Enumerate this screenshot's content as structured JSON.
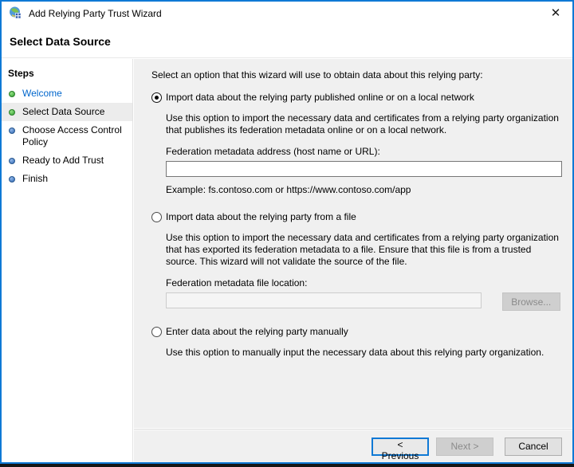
{
  "window": {
    "title": "Add Relying Party Trust Wizard",
    "close_glyph": "✕"
  },
  "header": {
    "title": "Select Data Source"
  },
  "sidebar": {
    "title": "Steps",
    "items": [
      {
        "label": "Welcome",
        "state": "done",
        "current": false
      },
      {
        "label": "Select Data Source",
        "state": "done",
        "current": true
      },
      {
        "label": "Choose Access Control Policy",
        "state": "todo",
        "current": false
      },
      {
        "label": "Ready to Add Trust",
        "state": "todo",
        "current": false
      },
      {
        "label": "Finish",
        "state": "todo",
        "current": false
      }
    ]
  },
  "main": {
    "instruction": "Select an option that this wizard will use to obtain data about this relying party:",
    "options": [
      {
        "label": "Import data about the relying party published online or on a local network",
        "selected": true,
        "description": "Use this option to import the necessary data and certificates from a relying party organization that publishes its federation metadata online or on a local network.",
        "field_label": "Federation metadata address (host name or URL):",
        "field_value": "",
        "example": "Example: fs.contoso.com or https://www.contoso.com/app"
      },
      {
        "label": "Import data about the relying party from a file",
        "selected": false,
        "description": "Use this option to import the necessary data and certificates from a relying party organization that has exported its federation metadata to a file. Ensure that this file is from a trusted source.  This wizard will not validate the source of the file.",
        "field_label": "Federation metadata file location:",
        "field_value": "",
        "browse_label": "Browse..."
      },
      {
        "label": "Enter data about the relying party manually",
        "selected": false,
        "description": "Use this option to manually input the necessary data about this relying party organization."
      }
    ]
  },
  "footer": {
    "previous_label": "< Previous",
    "next_label": "Next >",
    "cancel_label": "Cancel"
  },
  "colors": {
    "accent_border": "#0f79d5",
    "panel_gray": "#f0f0f0",
    "step_done_bullet": "#2f9e2f",
    "step_todo_bullet": "#2d66b3",
    "link_blue": "#0066cc",
    "current_step_bg": "#ececec",
    "disabled_button_bg": "#cfcfcf"
  }
}
